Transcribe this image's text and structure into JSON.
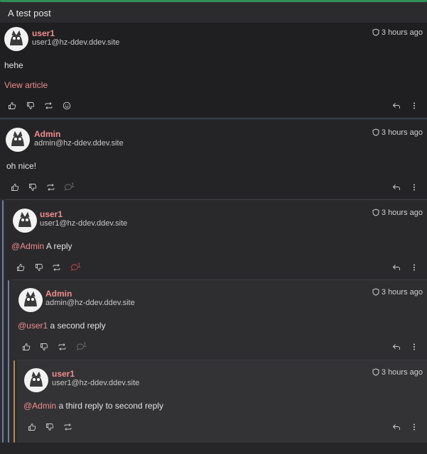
{
  "thread": {
    "title": "A test post"
  },
  "posts": [
    {
      "author": "user1",
      "handle": "user1@hz-ddev.ddev.site",
      "time": "3 hours ago",
      "body": "hehe",
      "link": "View article"
    },
    {
      "author": "Admin",
      "handle": "admin@hz-ddev.ddev.site",
      "time": "3 hours ago",
      "body": "oh nice!",
      "reply_count": "1"
    },
    {
      "author": "user1",
      "handle": "user1@hz-ddev.ddev.site",
      "time": "3 hours ago",
      "mention": "@Admin",
      "body": " A reply",
      "reply_count": "1"
    },
    {
      "author": "Admin",
      "handle": "admin@hz-ddev.ddev.site",
      "time": "3 hours ago",
      "mention": "@user1",
      "body": " a second reply",
      "reply_count": "1"
    },
    {
      "author": "user1",
      "handle": "user1@hz-ddev.ddev.site",
      "time": "3 hours ago",
      "mention": "@Admin",
      "body": " a third reply to second reply"
    }
  ],
  "colors": {
    "accent": "#f08c8c",
    "thread_line_blue": "#6b7fa8",
    "thread_line_orange": "#b9894f",
    "top_border": "#2f8f55"
  },
  "icons": {
    "like": "thumbs-up-icon",
    "dislike": "thumbs-down-icon",
    "boost": "repeat-icon",
    "react": "smiley-icon",
    "replies": "comment-icon",
    "reply": "reply-arrow-icon",
    "more": "more-vertical-icon",
    "time": "shield-icon"
  }
}
